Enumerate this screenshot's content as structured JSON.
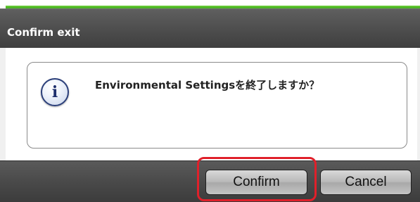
{
  "dialog": {
    "title": "Confirm exit",
    "message": "Environmental Settingsを終了しますか？",
    "info_icon_glyph": "i",
    "confirm_label": "Confirm",
    "cancel_label": "Cancel"
  },
  "colors": {
    "accent_green": "#4fbf24",
    "titlebar": "#4d4d4d",
    "highlight": "#e0202a"
  },
  "icons": {
    "info": "info-icon"
  }
}
